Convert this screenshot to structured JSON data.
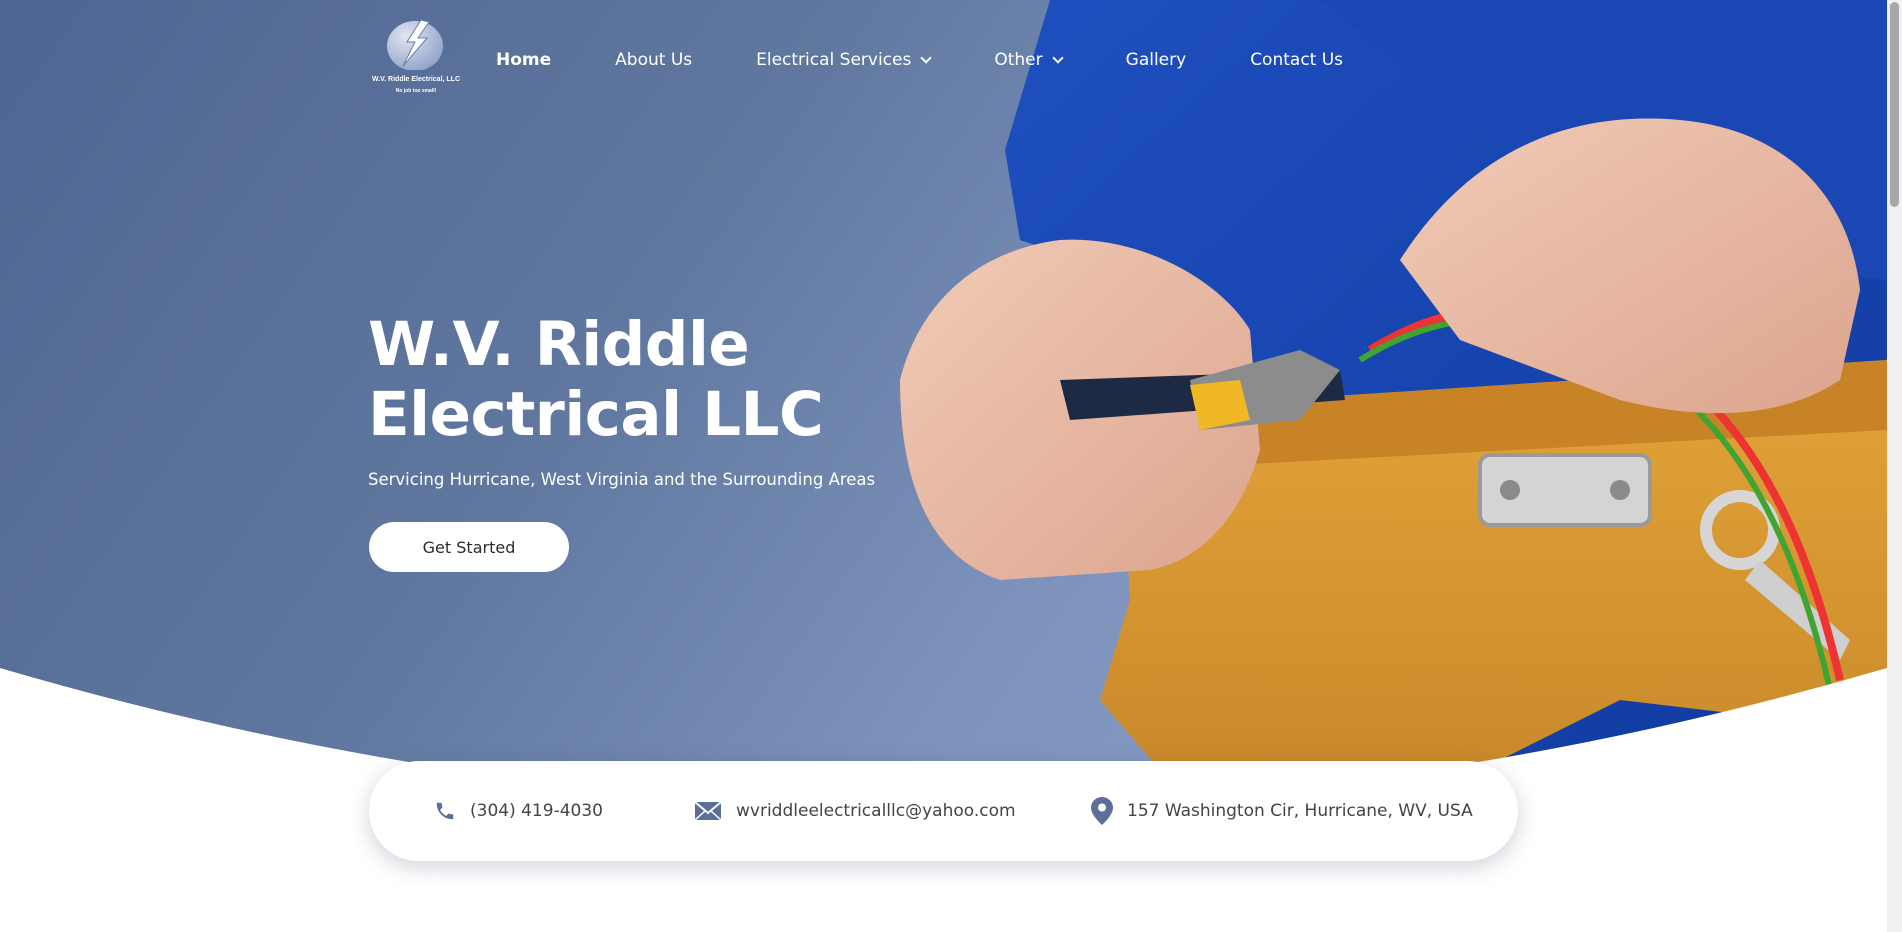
{
  "logo": {
    "name": "W.V. Riddle Electrical, LLC",
    "tagline": "No job too small!"
  },
  "nav": {
    "items": [
      {
        "label": "Home",
        "active": true,
        "dropdown": false
      },
      {
        "label": "About Us",
        "active": false,
        "dropdown": false
      },
      {
        "label": "Electrical Services",
        "active": false,
        "dropdown": true
      },
      {
        "label": "Other",
        "active": false,
        "dropdown": true
      },
      {
        "label": "Gallery",
        "active": false,
        "dropdown": false
      },
      {
        "label": "Contact Us",
        "active": false,
        "dropdown": false
      }
    ]
  },
  "hero": {
    "title_line1": "W.V. Riddle",
    "title_line2": "Electrical LLC",
    "subtitle": "Servicing Hurricane, West Virginia and the Surrounding Areas",
    "cta_label": "Get Started"
  },
  "contact": {
    "phone": "(304) 419-4030",
    "email": "wvriddleelectricalllc@yahoo.com",
    "address": "157 Washington Cir, Hurricane, WV, USA"
  },
  "icons": {
    "phone": "phone-icon",
    "email": "envelope-icon",
    "address": "map-pin-icon",
    "dropdown": "chevron-down-icon"
  },
  "colors": {
    "hero_blue": "#5f7399",
    "icon_blue": "#5b6f9a",
    "button_bg": "#ffffff",
    "text_white": "#ffffff"
  }
}
